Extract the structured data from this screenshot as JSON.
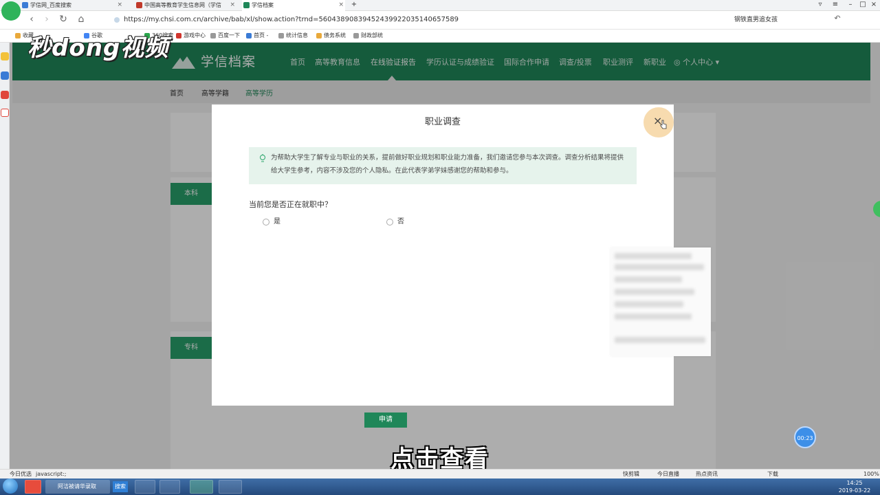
{
  "browser": {
    "tabs": [
      {
        "label": "学信网_百度搜索",
        "color": "#3a7bd5"
      },
      {
        "label": "中国高等教育学生信息网（学信",
        "color": "#c0392b"
      },
      {
        "label": "学信档案",
        "color": "#1f8759"
      }
    ],
    "url": "https://my.chsi.com.cn/archive/bab/xl/show.action?trnd=56043890839452439922035140657589",
    "search_text": "钢铁直男追女孩",
    "bookmarks": [
      {
        "label": "收藏",
        "color": "#e9a93b"
      },
      {
        "label": "谷歌",
        "color": "#4285f4"
      },
      {
        "label": "360搜索",
        "color": "#2aa54c"
      },
      {
        "label": "游戏中心",
        "color": "#d0352d"
      },
      {
        "label": "百度一下",
        "color": "#999999"
      },
      {
        "label": "首页 -",
        "color": "#3a7bd5"
      },
      {
        "label": "统计信息",
        "color": "#999999"
      },
      {
        "label": "债务系统",
        "color": "#e9a93b"
      },
      {
        "label": "财政部统",
        "color": "#999999"
      }
    ]
  },
  "site": {
    "logo": "学信档案",
    "nav": [
      "首页",
      "高等教育信息",
      "在线验证报告",
      "学历认证与成绩验证",
      "国际合作申请",
      "调查/投票",
      "职业测评",
      "新职业",
      "个人中心"
    ],
    "active_nav": "在线验证报告",
    "subnav": [
      "首页",
      "高等学籍",
      "高等学历"
    ],
    "active_subnav": "高等学历",
    "card_tabs": [
      "本科",
      "专科"
    ],
    "apply_button": "申请"
  },
  "modal": {
    "title": "职业调查",
    "close_icon": "close-icon",
    "notice": "为帮助大学生了解专业与职业的关系，提前做好职业规划和职业能力准备，我们邀请您参与本次调查。调查分析结果将提供给大学生参考，内容不涉及您的个人隐私。在此代表学弟学妹感谢您的帮助和参与。",
    "question": "当前您是否正在就职中？",
    "options": [
      "是",
      "否"
    ]
  },
  "overlay": {
    "watermark": "秒dong视频",
    "subtitle": "点击查看",
    "timer": "00:23"
  },
  "statusbar": {
    "left_label": "今日优选",
    "status_text": "javascript:;",
    "items": [
      "快剪辑",
      "今日直播",
      "热点资讯",
      "下载",
      "100%"
    ]
  },
  "taskbar": {
    "item": "阿洁被请华录取",
    "button": "搜索",
    "time": "14:25",
    "date": "2019-03-22"
  },
  "colors": {
    "brand_green": "#1f8759",
    "tab_green": "#28a06a",
    "notice_bg": "#e6f3ec"
  }
}
